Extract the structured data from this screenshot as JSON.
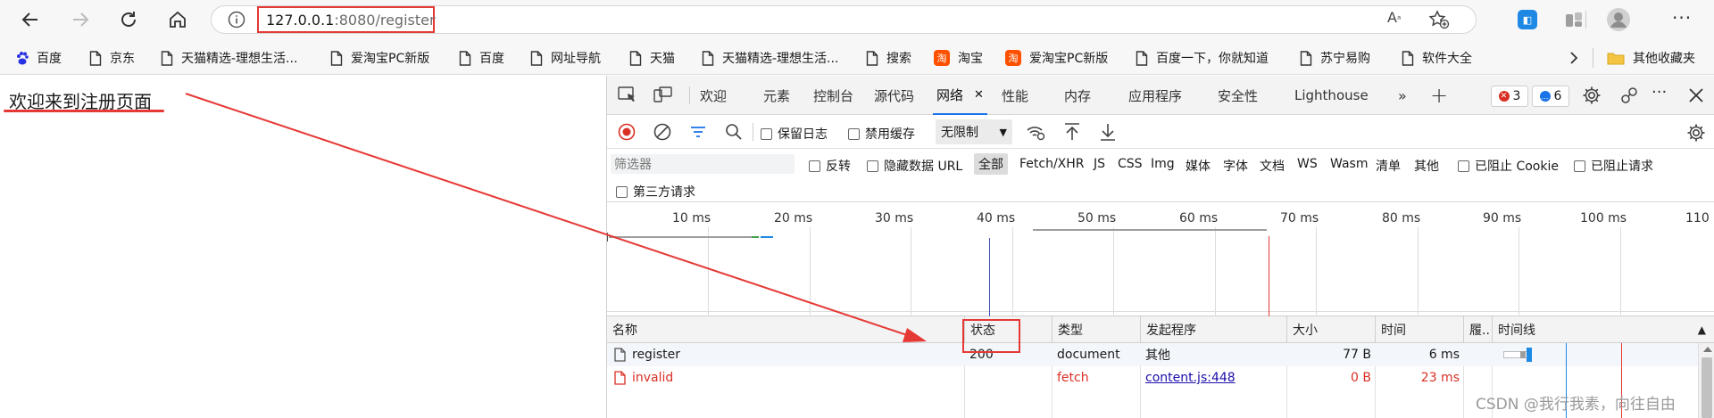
{
  "browser": {
    "url_host": "127.0.0.1",
    "url_rest": ":8080/register"
  },
  "bookmarks": [
    {
      "label": "百度",
      "icon": "baidu-paw-icon"
    },
    {
      "label": "京东",
      "icon": "page-icon"
    },
    {
      "label": "天猫精选-理想生活...",
      "icon": "page-icon"
    },
    {
      "label": "爱淘宝PC新版",
      "icon": "page-icon"
    },
    {
      "label": "百度",
      "icon": "page-icon"
    },
    {
      "label": "网址导航",
      "icon": "page-icon"
    },
    {
      "label": "天猫",
      "icon": "page-icon"
    },
    {
      "label": "天猫精选-理想生活...",
      "icon": "page-icon"
    },
    {
      "label": "搜索",
      "icon": "page-icon"
    },
    {
      "label": "淘宝",
      "icon": "taobao-icon"
    },
    {
      "label": "爱淘宝PC新版",
      "icon": "taobao-icon"
    },
    {
      "label": "百度一下，你就知道",
      "icon": "page-icon"
    },
    {
      "label": "苏宁易购",
      "icon": "page-icon"
    },
    {
      "label": "软件大全",
      "icon": "page-icon"
    }
  ],
  "other_bookmarks": "其他收藏夹",
  "page": {
    "heading": "欢迎来到注册页面"
  },
  "devtools": {
    "tabs": [
      "欢迎",
      "元素",
      "控制台",
      "源代码",
      "网络",
      "性能",
      "内存",
      "应用程序",
      "安全性",
      "Lighthouse"
    ],
    "active_tab": "网络",
    "error_count": "3",
    "message_count": "6",
    "preserve_log": "保留日志",
    "disable_cache": "禁用缓存",
    "throttle": "无限制",
    "filter_placeholder": "筛选器",
    "invert": "反转",
    "hide_data_url": "隐藏数据 URL",
    "filter_types": [
      "全部",
      "Fetch/XHR",
      "JS",
      "CSS",
      "Img",
      "媒体",
      "字体",
      "文档",
      "WS",
      "Wasm",
      "清单",
      "其他"
    ],
    "blocked_cookies": "已阻止 Cookie",
    "blocked_requests": "已阻止请求",
    "third_party": "第三方请求",
    "timeline_ticks": [
      "10 ms",
      "20 ms",
      "30 ms",
      "40 ms",
      "50 ms",
      "60 ms",
      "70 ms",
      "80 ms",
      "90 ms",
      "100 ms",
      "110"
    ],
    "columns": [
      "名称",
      "状态",
      "类型",
      "发起程序",
      "大小",
      "时间",
      "履..",
      "时间线"
    ],
    "requests": [
      {
        "name": "register",
        "status": "200",
        "type": "document",
        "initiator": "其他",
        "size": "77 B",
        "time": "6 ms",
        "failed": false
      },
      {
        "name": "invalid",
        "status": "",
        "type": "fetch",
        "initiator": "content.js:448",
        "size": "0 B",
        "time": "23 ms",
        "failed": true
      }
    ]
  },
  "watermark": "CSDN @我行我素，向往自由",
  "colors": {
    "accent_red": "#e53935",
    "link_blue": "#1a0dab",
    "devtools_blue": "#1a73e8"
  }
}
